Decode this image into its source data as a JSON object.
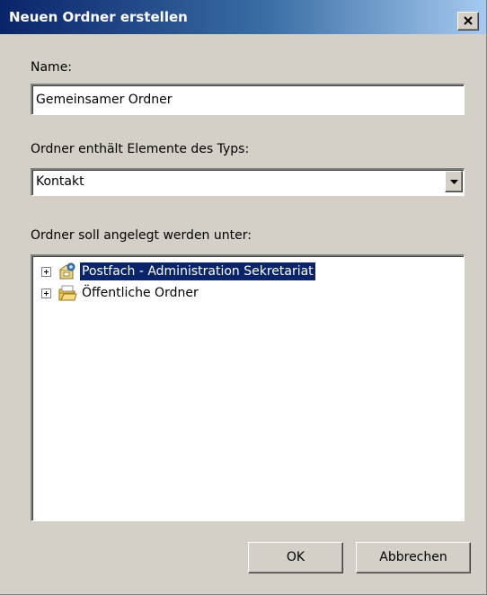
{
  "window": {
    "title": "Neuen Ordner erstellen"
  },
  "name_field": {
    "label": "Name:",
    "value": "Gemeinsamer Ordner"
  },
  "type_field": {
    "label": "Ordner enthält Elemente des Typs:",
    "value": "Kontakt"
  },
  "location": {
    "label": "Ordner soll angelegt werden unter:",
    "items": [
      {
        "label": "Postfach - Administration Sekretariat",
        "icon": "mailbox-icon",
        "selected": true
      },
      {
        "label": "Öffentliche Ordner",
        "icon": "public-folders-icon",
        "selected": false
      }
    ]
  },
  "buttons": {
    "ok": "OK",
    "cancel": "Abbrechen"
  },
  "colors": {
    "dialog_bg": "#d4d0c8",
    "title_gradient_start": "#0a246a",
    "title_gradient_end": "#a6caf0",
    "selection": "#0a246a"
  }
}
